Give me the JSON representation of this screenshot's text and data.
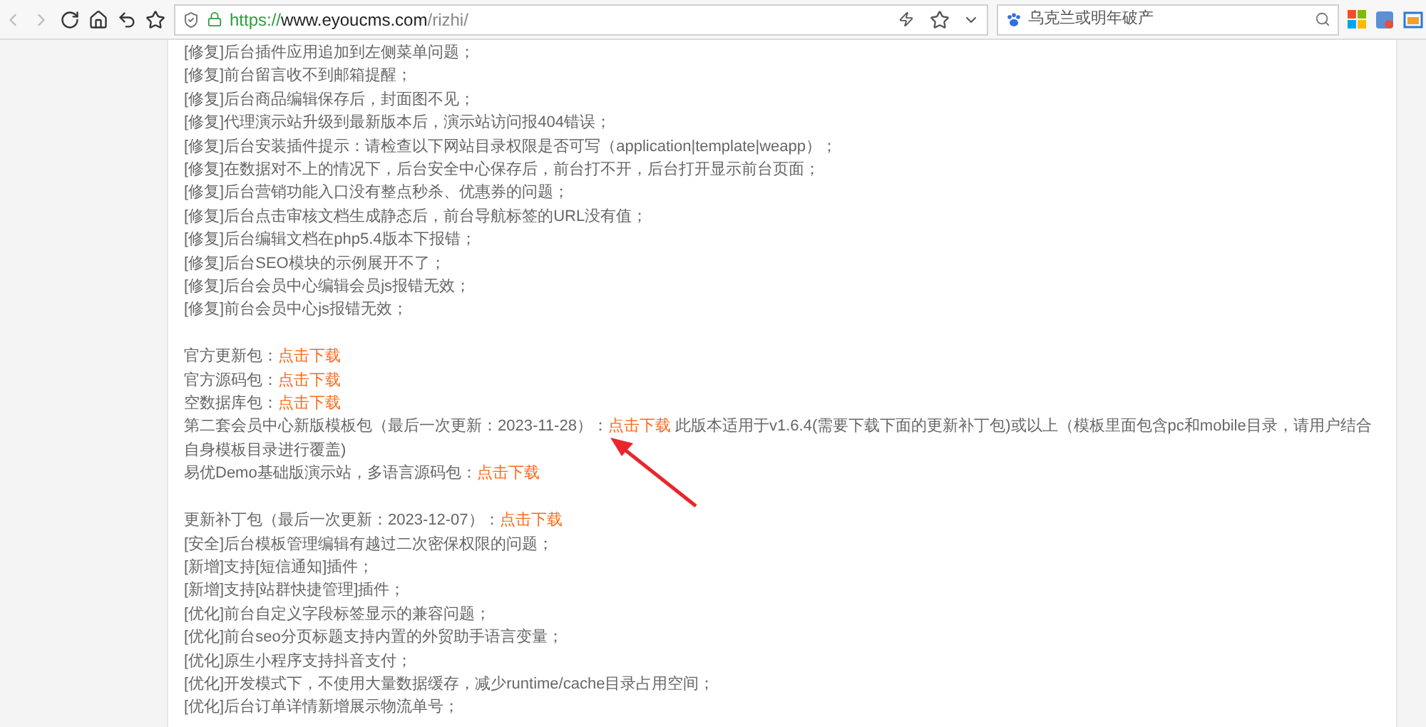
{
  "toolbar": {
    "url": {
      "scheme": "https://",
      "host": "www.eyoucms.com",
      "path": "/rizhi/"
    },
    "search": {
      "placeholder": "乌克兰或明年破产"
    }
  },
  "sections": [
    [
      {
        "parts": [
          {
            "kind": "text",
            "text": "[修复]后台插件应用追加到左侧菜单问题；"
          }
        ]
      },
      {
        "parts": [
          {
            "kind": "text",
            "text": "[修复]前台留言收不到邮箱提醒；"
          }
        ]
      },
      {
        "parts": [
          {
            "kind": "text",
            "text": "[修复]后台商品编辑保存后，封面图不见；"
          }
        ]
      },
      {
        "parts": [
          {
            "kind": "text",
            "text": "[修复]代理演示站升级到最新版本后，演示站访问报404错误；"
          }
        ]
      },
      {
        "parts": [
          {
            "kind": "text",
            "text": "[修复]后台安装插件提示：请检查以下网站目录权限是否可写（application|template|weapp）；"
          }
        ]
      },
      {
        "parts": [
          {
            "kind": "text",
            "text": "[修复]在数据对不上的情况下，后台安全中心保存后，前台打不开，后台打开显示前台页面；"
          }
        ]
      },
      {
        "parts": [
          {
            "kind": "text",
            "text": "[修复]后台营销功能入口没有整点秒杀、优惠券的问题；"
          }
        ]
      },
      {
        "parts": [
          {
            "kind": "text",
            "text": "[修复]后台点击审核文档生成静态后，前台导航标签的URL没有值；"
          }
        ]
      },
      {
        "parts": [
          {
            "kind": "text",
            "text": "[修复]后台编辑文档在php5.4版本下报错；"
          }
        ]
      },
      {
        "parts": [
          {
            "kind": "text",
            "text": "[修复]后台SEO模块的示例展开不了；"
          }
        ]
      },
      {
        "parts": [
          {
            "kind": "text",
            "text": "[修复]后台会员中心编辑会员js报错无效；"
          }
        ]
      },
      {
        "parts": [
          {
            "kind": "text",
            "text": "[修复]前台会员中心js报错无效；"
          }
        ]
      }
    ],
    [
      {
        "parts": [
          {
            "kind": "text",
            "text": "官方更新包："
          },
          {
            "kind": "link",
            "text": "点击下载"
          }
        ]
      },
      {
        "parts": [
          {
            "kind": "text",
            "text": "官方源码包："
          },
          {
            "kind": "link",
            "text": "点击下载"
          }
        ]
      },
      {
        "parts": [
          {
            "kind": "text",
            "text": "空数据库包："
          },
          {
            "kind": "link",
            "text": "点击下载"
          }
        ]
      },
      {
        "parts": [
          {
            "kind": "text",
            "text": "第二套会员中心新版模板包（最后一次更新：2023-11-28）："
          },
          {
            "kind": "link",
            "text": "点击下载"
          },
          {
            "kind": "text",
            "text": " 此版本适用于v1.6.4(需要下载下面的更新补丁包)或以上（模板里面包含pc和mobile目录，请用户结合自身模板目录进行覆盖)"
          }
        ]
      },
      {
        "parts": [
          {
            "kind": "text",
            "text": "易优Demo基础版演示站，多语言源码包："
          },
          {
            "kind": "link",
            "text": "点击下载"
          }
        ]
      }
    ],
    [
      {
        "parts": [
          {
            "kind": "text",
            "text": "更新补丁包（最后一次更新：2023-12-07）："
          },
          {
            "kind": "link",
            "text": "点击下载"
          }
        ]
      },
      {
        "parts": [
          {
            "kind": "text",
            "text": "[安全]后台模板管理编辑有越过二次密保权限的问题；"
          }
        ]
      },
      {
        "parts": [
          {
            "kind": "text",
            "text": "[新增]支持[短信通知]插件；"
          }
        ]
      },
      {
        "parts": [
          {
            "kind": "text",
            "text": "[新增]支持[站群快捷管理]插件；"
          }
        ]
      },
      {
        "parts": [
          {
            "kind": "text",
            "text": "[优化]前台自定义字段标签显示的兼容问题；"
          }
        ]
      },
      {
        "parts": [
          {
            "kind": "text",
            "text": "[优化]前台seo分页标题支持内置的外贸助手语言变量；"
          }
        ]
      },
      {
        "parts": [
          {
            "kind": "text",
            "text": "[优化]原生小程序支持抖音支付；"
          }
        ]
      },
      {
        "parts": [
          {
            "kind": "text",
            "text": "[优化]开发模式下，不使用大量数据缓存，减少runtime/cache目录占用空间；"
          }
        ]
      },
      {
        "parts": [
          {
            "kind": "text",
            "text": "[优化]后台订单详情新增展示物流单号；"
          }
        ]
      }
    ]
  ]
}
